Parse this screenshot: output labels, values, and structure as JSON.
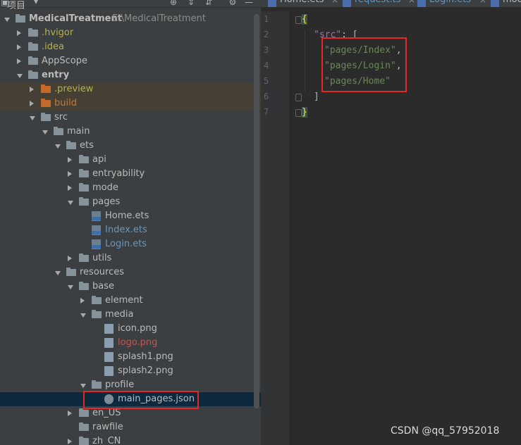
{
  "project_panel": {
    "title": "项目",
    "toolbar_icons": [
      "target-icon",
      "collapse-icon",
      "expand-icon",
      "settings-icon",
      "hide-icon"
    ]
  },
  "tree": [
    {
      "label": "MedicalTreatment",
      "path": "E:\\MedicalTreatment",
      "depth": 0,
      "expanded": true,
      "kind": "module",
      "style": "bold"
    },
    {
      "label": ".hvigor",
      "depth": 1,
      "expanded": false,
      "kind": "folder",
      "style": "olive"
    },
    {
      "label": ".idea",
      "depth": 1,
      "expanded": false,
      "kind": "folder",
      "style": "olive"
    },
    {
      "label": "AppScope",
      "depth": 1,
      "expanded": false,
      "kind": "folder",
      "style": "normal"
    },
    {
      "label": "entry",
      "depth": 1,
      "expanded": true,
      "kind": "module",
      "style": "bold"
    },
    {
      "label": ".preview",
      "depth": 2,
      "expanded": false,
      "kind": "folder-orange",
      "style": "olive",
      "highlight": true
    },
    {
      "label": "build",
      "depth": 2,
      "expanded": false,
      "kind": "folder-orange",
      "style": "orange",
      "highlight": true
    },
    {
      "label": "src",
      "depth": 2,
      "expanded": true,
      "kind": "folder",
      "style": "normal"
    },
    {
      "label": "main",
      "depth": 3,
      "expanded": true,
      "kind": "folder",
      "style": "normal"
    },
    {
      "label": "ets",
      "depth": 4,
      "expanded": true,
      "kind": "folder",
      "style": "normal"
    },
    {
      "label": "api",
      "depth": 5,
      "expanded": false,
      "kind": "folder",
      "style": "normal"
    },
    {
      "label": "entryability",
      "depth": 5,
      "expanded": false,
      "kind": "folder",
      "style": "normal"
    },
    {
      "label": "mode",
      "depth": 5,
      "expanded": false,
      "kind": "folder",
      "style": "normal"
    },
    {
      "label": "pages",
      "depth": 5,
      "expanded": true,
      "kind": "folder",
      "style": "normal"
    },
    {
      "label": "Home.ets",
      "depth": 6,
      "kind": "ets",
      "style": "normal"
    },
    {
      "label": "Index.ets",
      "depth": 6,
      "kind": "ets",
      "style": "blue"
    },
    {
      "label": "Login.ets",
      "depth": 6,
      "kind": "ets",
      "style": "blue"
    },
    {
      "label": "utils",
      "depth": 5,
      "expanded": false,
      "kind": "folder",
      "style": "normal"
    },
    {
      "label": "resources",
      "depth": 4,
      "expanded": true,
      "kind": "folder",
      "style": "normal"
    },
    {
      "label": "base",
      "depth": 5,
      "expanded": true,
      "kind": "folder",
      "style": "normal"
    },
    {
      "label": "element",
      "depth": 6,
      "expanded": false,
      "kind": "folder",
      "style": "normal"
    },
    {
      "label": "media",
      "depth": 6,
      "expanded": true,
      "kind": "folder",
      "style": "normal"
    },
    {
      "label": "icon.png",
      "depth": 7,
      "kind": "png",
      "style": "normal"
    },
    {
      "label": "logo.png",
      "depth": 7,
      "kind": "png",
      "style": "red"
    },
    {
      "label": "splash1.png",
      "depth": 7,
      "kind": "png",
      "style": "normal"
    },
    {
      "label": "splash2.png",
      "depth": 7,
      "kind": "png",
      "style": "normal"
    },
    {
      "label": "profile",
      "depth": 6,
      "expanded": true,
      "kind": "folder",
      "style": "normal"
    },
    {
      "label": "main_pages.json",
      "depth": 7,
      "kind": "json",
      "style": "normal",
      "selected": true
    },
    {
      "label": "en_US",
      "depth": 5,
      "expanded": false,
      "kind": "folder",
      "style": "normal"
    },
    {
      "label": "rawfile",
      "depth": 5,
      "kind": "folder",
      "style": "normal"
    },
    {
      "label": "zh_CN",
      "depth": 5,
      "expanded": false,
      "kind": "folder",
      "style": "normal"
    }
  ],
  "editor": {
    "tabs": [
      {
        "label": "Home.ets",
        "active": true
      },
      {
        "label": "request.ts",
        "active": false
      },
      {
        "label": "Login.ets",
        "active": false
      },
      {
        "label": "mod",
        "active": false
      }
    ],
    "line_numbers": [
      "1",
      "2",
      "3",
      "4",
      "5",
      "6",
      "7"
    ],
    "code": {
      "l1": "{",
      "l2_key": "\"src\"",
      "l2_rest": ": [",
      "l3": "\"pages/Index\"",
      "l4": "\"pages/Login\"",
      "l5": "\"pages/Home\"",
      "comma": ",",
      "l6": "]",
      "l7": "}"
    }
  },
  "watermark": "CSDN @qq_57952018",
  "colors": {
    "highlight_box": "#e4282a",
    "selection": "#0d293e"
  }
}
